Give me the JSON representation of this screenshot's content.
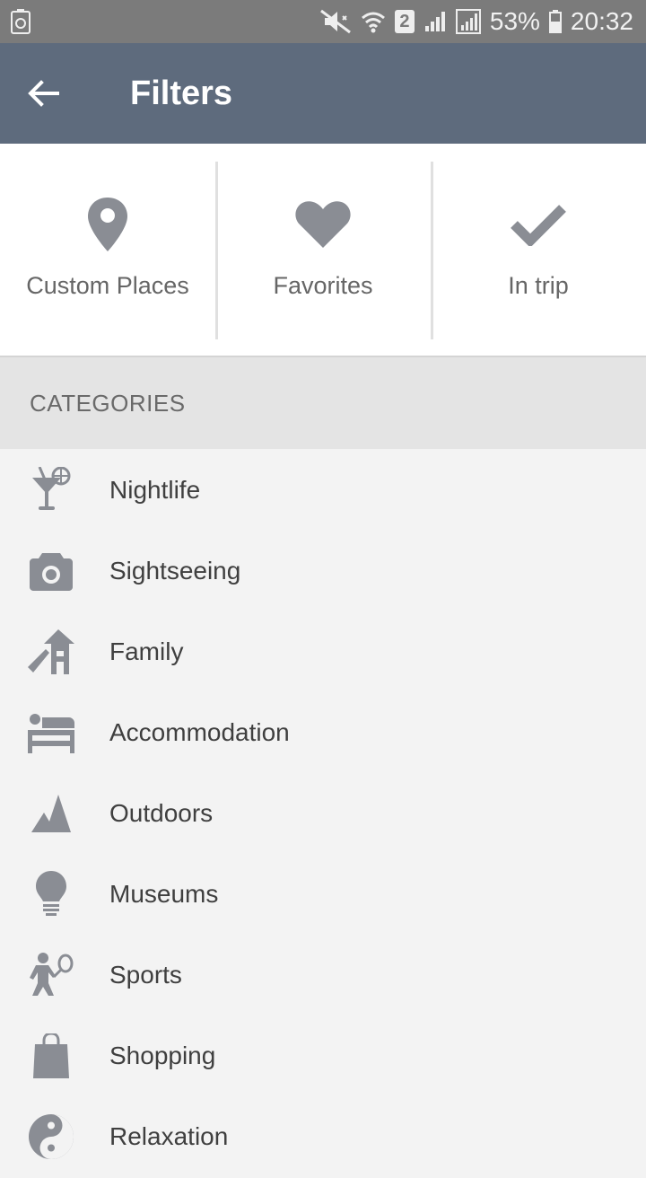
{
  "status_bar": {
    "battery_percent": "53%",
    "time": "20:32",
    "sim_badge": "2"
  },
  "app_bar": {
    "title": "Filters"
  },
  "filters": [
    {
      "label": "Custom Places",
      "icon": "map-pin-icon"
    },
    {
      "label": "Favorites",
      "icon": "heart-icon"
    },
    {
      "label": "In trip",
      "icon": "checkmark-icon"
    }
  ],
  "categories": {
    "header": "CATEGORIES",
    "items": [
      {
        "label": "Nightlife",
        "icon": "cocktail-icon"
      },
      {
        "label": "Sightseeing",
        "icon": "camera-icon"
      },
      {
        "label": "Family",
        "icon": "playground-slide-icon"
      },
      {
        "label": "Accommodation",
        "icon": "bed-icon"
      },
      {
        "label": "Outdoors",
        "icon": "mountain-icon"
      },
      {
        "label": "Museums",
        "icon": "lightbulb-icon"
      },
      {
        "label": "Sports",
        "icon": "tennis-player-icon"
      },
      {
        "label": "Shopping",
        "icon": "shopping-bag-icon"
      },
      {
        "label": "Relaxation",
        "icon": "yin-yang-icon"
      }
    ]
  },
  "colors": {
    "app_bar": "#5e6b7d",
    "status_bar": "#7b7b7b",
    "icon_gray": "#8a8d94",
    "background": "#f3f3f3"
  }
}
